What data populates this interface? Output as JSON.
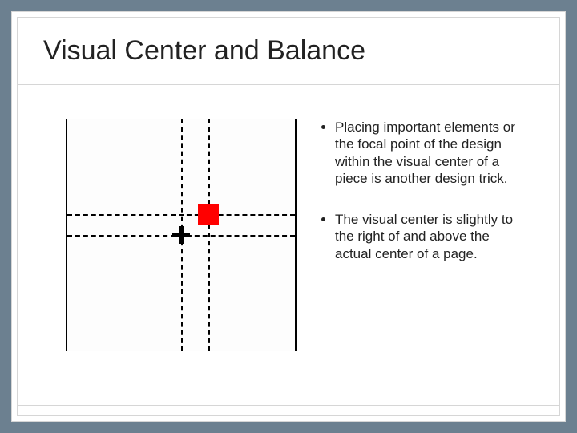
{
  "title": "Visual Center and Balance",
  "bullets": [
    "Placing important elements or the focal point of the design within the visual center of a piece is another design trick.",
    "The visual center is slightly to the right of and above the actual center of a page."
  ],
  "diagram": {
    "visual_center_marker": "red-square",
    "actual_center_marker": "plus"
  }
}
